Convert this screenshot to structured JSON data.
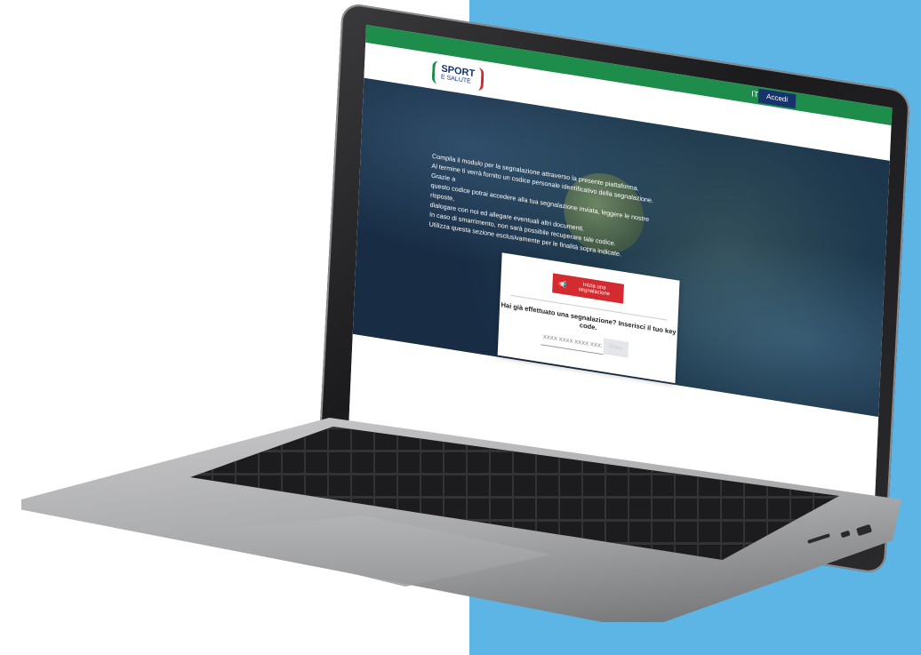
{
  "background": {
    "left_color": "#ffffff",
    "right_color": "#5cb5e4"
  },
  "site": {
    "topbar": {
      "lang": "IT",
      "login_label": "Accedi",
      "bar_color": "#1e8c4a",
      "login_color": "#17336b"
    },
    "logo": {
      "line1": "SPORT",
      "line2": "E SALUTE"
    },
    "hero": {
      "lines": [
        "Compila il modulo per la segnalazione attraverso la presente piattaforma.",
        "Al termine ti verrà fornito un codice personale identificativo della segnalazione. Grazie a",
        "questo codice potrai accedere alla tua segnalazione inviata, leggere le nostre risposte,",
        "dialogare con noi ed allegare eventuali altri documenti.",
        "In caso di smarrimento, non sarà possibile recuperare tale codice.",
        "Utilizza questa sezione esclusivamente per le finalità sopra indicate."
      ]
    },
    "card": {
      "report_button": "Inizia una segnalazione",
      "report_color": "#d42b30",
      "question": "Hai già effettuato una segnalazione? Inserisci il tuo key code.",
      "keycode_placeholder": "XXXX XXXX XXXX XXXX",
      "enter_label": "Entra"
    }
  }
}
